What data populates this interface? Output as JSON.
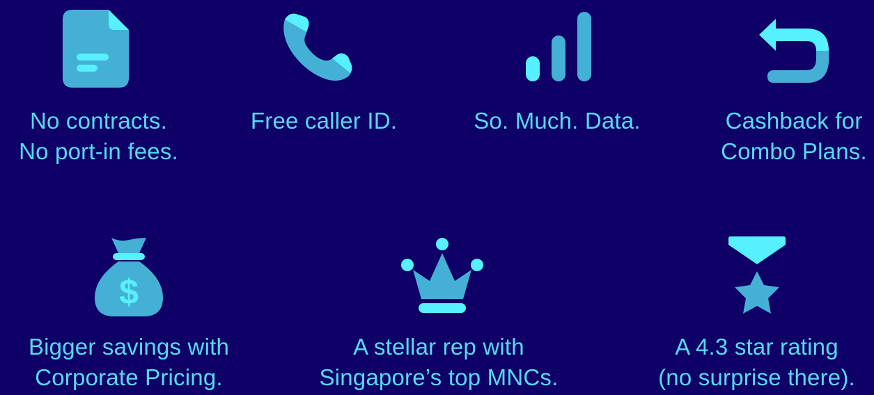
{
  "colors": {
    "background": "#0f0067",
    "text": "#56d9f1",
    "icon_primary": "#45b0d6",
    "icon_highlight": "#56f0ff"
  },
  "features": [
    {
      "icon": "document-icon",
      "line1": "No contracts.",
      "line2": "No port-in fees."
    },
    {
      "icon": "phone-icon",
      "line1": "Free caller ID.",
      "line2": ""
    },
    {
      "icon": "signal-bars-icon",
      "line1": "So. Much. Data.",
      "line2": ""
    },
    {
      "icon": "return-arrow-icon",
      "line1": "Cashback for",
      "line2": "Combo Plans."
    },
    {
      "icon": "money-bag-icon",
      "line1": "Bigger savings with",
      "line2": "Corporate Pricing."
    },
    {
      "icon": "crown-icon",
      "line1": "A stellar rep with",
      "line2": "Singapore’s top MNCs."
    },
    {
      "icon": "star-medal-icon",
      "line1": "A 4.3 star rating",
      "line2": "(no surprise there)."
    }
  ]
}
